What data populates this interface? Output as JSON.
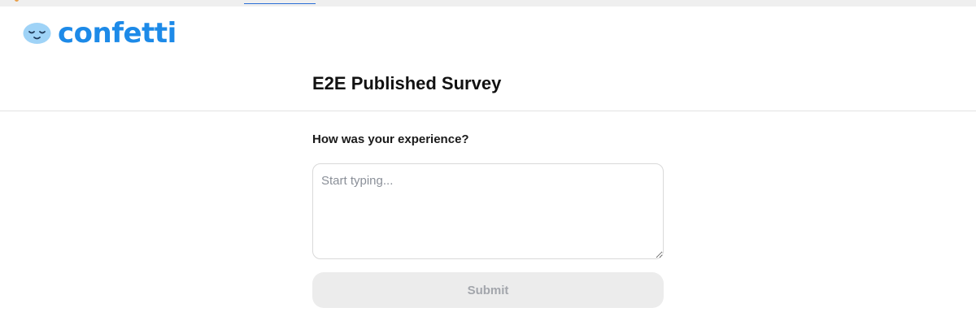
{
  "brand": {
    "logo_text": "confetti",
    "logo_icon": "sleepy-face-icon",
    "accent_color": "#1d8ae8"
  },
  "survey": {
    "title": "E2E Published Survey",
    "question": "How was your experience?",
    "answer_value": "",
    "answer_placeholder": "Start typing...",
    "submit_label": "Submit",
    "submit_enabled": false
  }
}
